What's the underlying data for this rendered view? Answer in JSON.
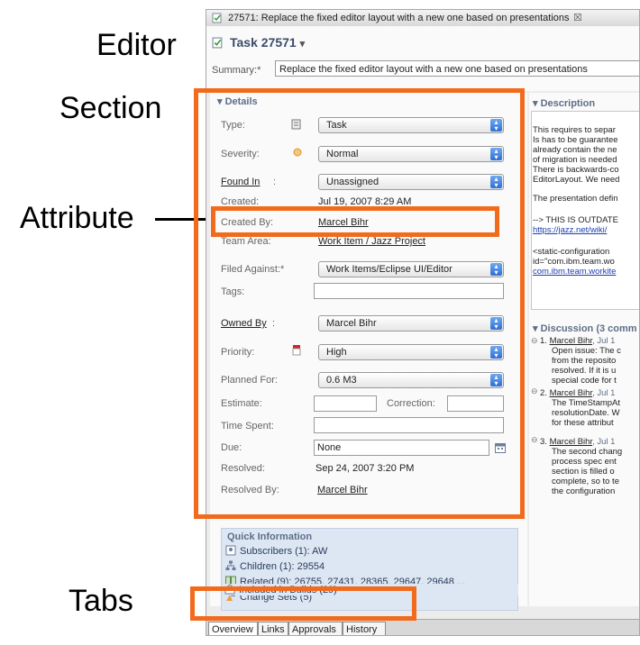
{
  "callouts": {
    "editor": "Editor",
    "section": "Section",
    "attribute": "Attribute",
    "tabs": "Tabs"
  },
  "colors": {
    "highlight": "#f26a1b",
    "link": "#1c3fb0",
    "section_header": "#5e6e88"
  },
  "window": {
    "tab_title": "27571: Replace the fixed editor layout with a new one based on presentations",
    "close_glyph": "☒"
  },
  "editor": {
    "task_title": "Task 27571",
    "task_dropdown_glyph": "▾",
    "summary_label": "Summary:*",
    "summary_value": "Replace the fixed editor layout with a new one based on presentations"
  },
  "details": {
    "header": "▾ Details",
    "type": {
      "label": "Type:",
      "value": "Task"
    },
    "severity": {
      "label": "Severity:",
      "value": "Normal"
    },
    "found_in": {
      "label": "Found In",
      "value": "Unassigned"
    },
    "created": {
      "label": "Created:",
      "value": "Jul 19, 2007 8:29 AM"
    },
    "created_by": {
      "label": "Created By:",
      "value": "Marcel Bihr"
    },
    "team_area": {
      "label": "Team Area:",
      "value": "Work Item / Jazz Project"
    },
    "filed_against": {
      "label": "Filed Against:*",
      "value": "Work Items/Eclipse UI/Editor"
    },
    "tags": {
      "label": "Tags:",
      "value": ""
    },
    "owned_by": {
      "label": "Owned By",
      "value": "Marcel Bihr"
    },
    "priority": {
      "label": "Priority:",
      "value": "High"
    },
    "planned_for": {
      "label": "Planned For:",
      "value": "0.6 M3"
    },
    "estimate": {
      "label": "Estimate:",
      "value": ""
    },
    "correction": {
      "label": "Correction:",
      "value": ""
    },
    "time_spent": {
      "label": "Time Spent:",
      "value": ""
    },
    "due": {
      "label": "Due:",
      "value": "None"
    },
    "resolved": {
      "label": "Resolved:",
      "value": "Sep 24, 2007 3:20 PM"
    },
    "resolved_by": {
      "label": "Resolved By:",
      "value": "Marcel Bihr"
    }
  },
  "quick_info": {
    "header": "Quick Information",
    "subscribers": "Subscribers (1): AW",
    "children": "Children (1): 29554",
    "related": "Related (9): 26755, 27431, 28365, 29647, 29648 ...",
    "change_sets": "Change Sets (5)",
    "included_in_builds": "Included in Builds (29)"
  },
  "description": {
    "header": "▾ Description",
    "lines": [
      "This requires to separ",
      "Is has to be guarantee",
      "already contain the ne",
      "of migration is needed",
      "There is backwards-co",
      "EditorLayout. We need"
    ],
    "line2": "The presentation defin",
    "outdated": "--> THIS IS OUTDATE",
    "outdated_link": "https://jazz.net/wiki/",
    "static_lines": [
      "<static-configuration",
      "id=\"com.ibm.team.wo"
    ],
    "static_link": "com.ibm.team.workite"
  },
  "discussion": {
    "header": "▾ Discussion (3 comm",
    "items": [
      {
        "num": "1.",
        "author": "Marcel Bihr",
        "date": ", Jul 1",
        "lines": [
          "Open issue: The c",
          "from the reposito",
          "resolved. If it is u",
          "special code for t"
        ]
      },
      {
        "num": "2.",
        "author": "Marcel Bihr",
        "date": ", Jul 1",
        "lines": [
          "The TimeStampAt",
          "resolutionDate. W",
          "for these attribut"
        ]
      },
      {
        "num": "3.",
        "author": "Marcel Bihr",
        "date": ", Jul 1",
        "lines": [
          "The second chang",
          "process spec ent",
          "section is filled o",
          "complete, so to te",
          "the configuration"
        ]
      }
    ]
  },
  "bottom_tabs": [
    "Overview",
    "Links",
    "Approvals",
    "History"
  ]
}
